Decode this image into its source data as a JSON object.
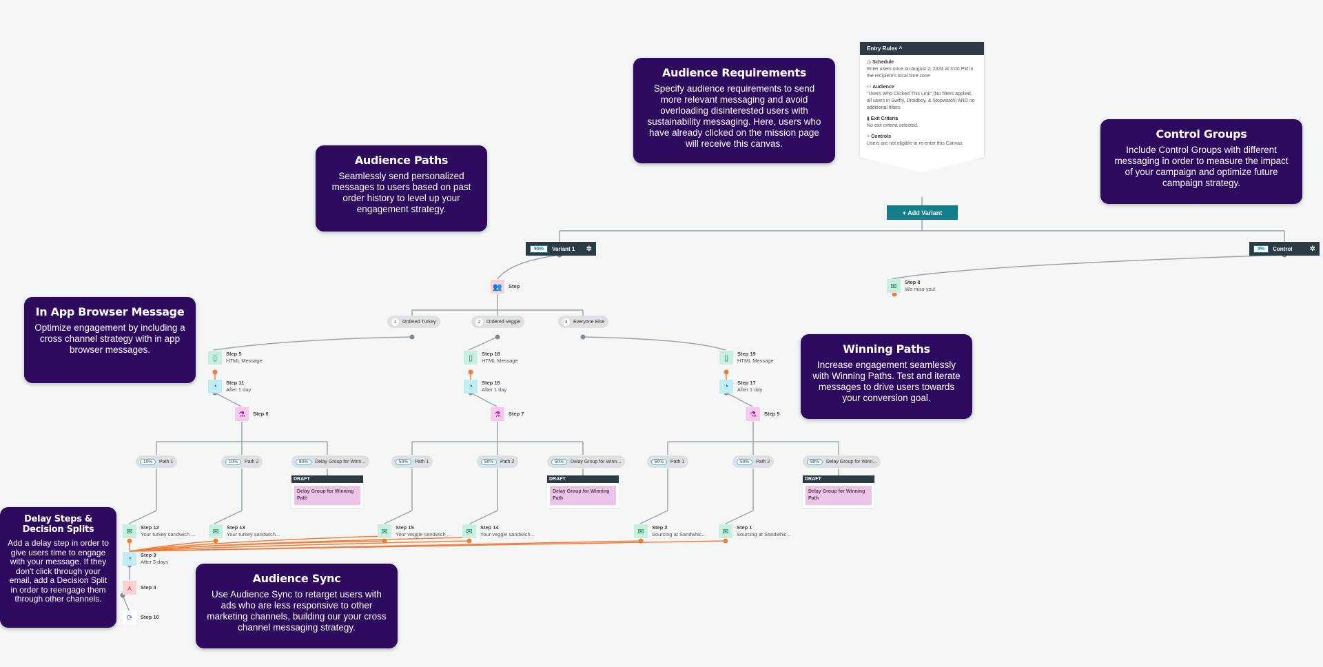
{
  "callouts": {
    "audience_requirements": {
      "title": "Audience Requirements",
      "body": "Specify audience requirements to send more relevant messaging and avoid overloading disinterested users with sustainability messaging. Here, users who have already clicked on the mission page will receive this canvas."
    },
    "audience_paths": {
      "title": "Audience Paths",
      "body": "Seamlessly send personalized messages to users based on past order history to level up your engagement strategy."
    },
    "control_groups": {
      "title": "Control Groups",
      "body": "Include Control Groups with different messaging in order to measure the impact of your campaign and optimize future campaign strategy."
    },
    "in_app": {
      "title": "In App Browser Message",
      "body": "Optimize engagement by including a cross channel strategy with in app browser messages."
    },
    "winning_paths": {
      "title": "Winning Paths",
      "body": "Increase engagement seamlessly with Winning Paths. Test and iterate messages to drive users towards your conversion goal."
    },
    "delay_steps": {
      "title": "Delay Steps & Decision Splits",
      "body": "Add a delay step in order to give users time to engage with your message. If they don't click through your email, add a Decision Split in order to reengage them through other channels."
    },
    "audience_sync": {
      "title": "Audience Sync",
      "body": "Use Audience Sync to retarget users with ads who are less responsive to other marketing channels, building our your cross channel messaging strategy."
    }
  },
  "entry_rules": {
    "header": "Entry Rules ^",
    "schedule": {
      "title": "Schedule",
      "body": "Enter users once on August 2, 2024 at 3:00 PM in the recipient's local time zone"
    },
    "audience": {
      "title": "Audience",
      "body": "\"Users Who Clicked This Link\" (No filters applied, all users in Swifty, Droidboy, & Stopwatch) AND no additional filters"
    },
    "exit": {
      "title": "Exit Criteria",
      "body": "No exit criteria selected."
    },
    "controls": {
      "title": "Controls",
      "body": "Users are not eligible to re-enter this Canvas."
    }
  },
  "add_variant": "+ Add Variant",
  "variants": [
    {
      "pct": "95%",
      "name": "Variant 1"
    },
    {
      "pct": "5%",
      "name": "Control"
    }
  ],
  "steps": {
    "step8": {
      "title": "Step 8",
      "sub": "We miss you!"
    },
    "audience_step": {
      "title": "Step"
    },
    "s5": {
      "title": "Step 5",
      "sub": "HTML Message"
    },
    "s18": {
      "title": "Step 18",
      "sub": "HTML Message"
    },
    "s19": {
      "title": "Step 19",
      "sub": "HTML Message"
    },
    "s11": {
      "title": "Step 11",
      "sub": "After 1 day"
    },
    "s16": {
      "title": "Step 16",
      "sub": "After 1 day"
    },
    "s17": {
      "title": "Step 17",
      "sub": "After 1 day"
    },
    "s6": {
      "title": "Step 6"
    },
    "s7": {
      "title": "Step 7"
    },
    "s9": {
      "title": "Step 9"
    },
    "s12": {
      "title": "Step 12",
      "sub": "Your turkey sandwich ..."
    },
    "s13": {
      "title": "Step 13",
      "sub": "Your turkey sandwich..."
    },
    "s15": {
      "title": "Step 15",
      "sub": "Your veggie sandwich ..."
    },
    "s14": {
      "title": "Step 14",
      "sub": "Your veggie sandwich..."
    },
    "s2": {
      "title": "Step 2",
      "sub": "Sourcing at Sandwhic..."
    },
    "s1": {
      "title": "Step 1",
      "sub": "Sourcing at Sandwhic..."
    },
    "s3": {
      "title": "Step 3",
      "sub": "After 3 days"
    },
    "s4": {
      "title": "Step 4"
    },
    "s10": {
      "title": "Step 10"
    }
  },
  "audience_paths": [
    {
      "num": "1",
      "label": "Ordered Turkey"
    },
    {
      "num": "2",
      "label": "Ordered Veggie"
    },
    {
      "num": "3",
      "label": "Everyone Else"
    }
  ],
  "experiment_groups": [
    {
      "paths": [
        {
          "pct": "10%",
          "label": "Path 1"
        },
        {
          "pct": "10%",
          "label": "Path 2"
        },
        {
          "pct": "80%",
          "label": "Delay Group for Winn..."
        }
      ]
    },
    {
      "paths": [
        {
          "pct": "50%",
          "label": "Path 1"
        },
        {
          "pct": "50%",
          "label": "Path 2"
        },
        {
          "pct": "50%",
          "label": "Delay Group for Winn..."
        }
      ]
    },
    {
      "paths": [
        {
          "pct": "50%",
          "label": "Path 1"
        },
        {
          "pct": "50%",
          "label": "Path 2"
        },
        {
          "pct": "50%",
          "label": "Delay Group for Winn..."
        }
      ]
    }
  ],
  "draft": {
    "badge": "DRAFT",
    "label": "Delay Group for Winning Path"
  }
}
